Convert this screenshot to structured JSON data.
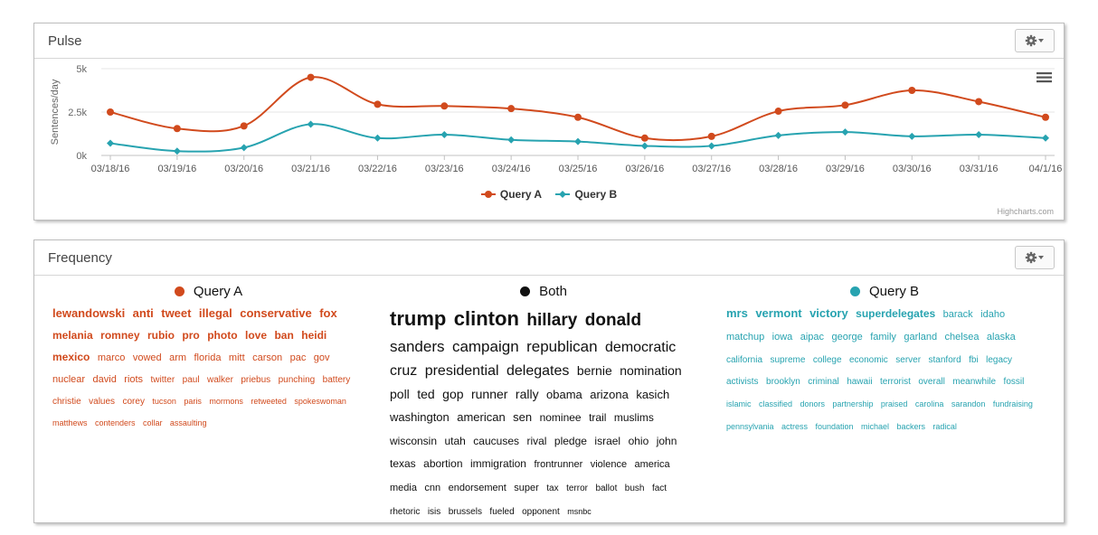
{
  "pulse": {
    "title": "Pulse",
    "credits": "Highcharts.com"
  },
  "frequency": {
    "title": "Frequency",
    "query_a_label": "Query A",
    "both_label": "Both",
    "query_b_label": "Query B",
    "query_a_words": [
      {
        "t": "lewandowski",
        "s": 13
      },
      {
        "t": "anti",
        "s": 13
      },
      {
        "t": "tweet",
        "s": 13
      },
      {
        "t": "illegal",
        "s": 13
      },
      {
        "t": "conservative",
        "s": 13
      },
      {
        "t": "fox",
        "s": 13
      },
      {
        "t": "melania",
        "s": 12
      },
      {
        "t": "romney",
        "s": 12
      },
      {
        "t": "rubio",
        "s": 12
      },
      {
        "t": "pro",
        "s": 12
      },
      {
        "t": "photo",
        "s": 12
      },
      {
        "t": "love",
        "s": 12
      },
      {
        "t": "ban",
        "s": 12
      },
      {
        "t": "heidi",
        "s": 12
      },
      {
        "t": "mexico",
        "s": 12
      },
      {
        "t": "marco",
        "s": 11
      },
      {
        "t": "vowed",
        "s": 11
      },
      {
        "t": "arm",
        "s": 11
      },
      {
        "t": "florida",
        "s": 11
      },
      {
        "t": "mitt",
        "s": 11
      },
      {
        "t": "carson",
        "s": 11
      },
      {
        "t": "pac",
        "s": 11
      },
      {
        "t": "gov",
        "s": 11
      },
      {
        "t": "nuclear",
        "s": 11
      },
      {
        "t": "david",
        "s": 11
      },
      {
        "t": "riots",
        "s": 11
      },
      {
        "t": "twitter",
        "s": 10
      },
      {
        "t": "paul",
        "s": 10
      },
      {
        "t": "walker",
        "s": 10
      },
      {
        "t": "priebus",
        "s": 10
      },
      {
        "t": "punching",
        "s": 10
      },
      {
        "t": "battery",
        "s": 10
      },
      {
        "t": "christie",
        "s": 10
      },
      {
        "t": "values",
        "s": 10
      },
      {
        "t": "corey",
        "s": 10
      },
      {
        "t": "tucson",
        "s": 9
      },
      {
        "t": "paris",
        "s": 9
      },
      {
        "t": "mormons",
        "s": 9
      },
      {
        "t": "retweeted",
        "s": 9
      },
      {
        "t": "spokeswoman",
        "s": 9
      },
      {
        "t": "matthews",
        "s": 9
      },
      {
        "t": "contenders",
        "s": 9
      },
      {
        "t": "collar",
        "s": 9
      },
      {
        "t": "assaulting",
        "s": 9
      }
    ],
    "both_words": [
      {
        "t": "trump",
        "s": 22
      },
      {
        "t": "clinton",
        "s": 22
      },
      {
        "t": "hillary",
        "s": 19
      },
      {
        "t": "donald",
        "s": 19
      },
      {
        "t": "sanders",
        "s": 17
      },
      {
        "t": "campaign",
        "s": 17
      },
      {
        "t": "republican",
        "s": 17
      },
      {
        "t": "democratic",
        "s": 16
      },
      {
        "t": "cruz",
        "s": 16
      },
      {
        "t": "presidential",
        "s": 16
      },
      {
        "t": "delegates",
        "s": 16
      },
      {
        "t": "bernie",
        "s": 14
      },
      {
        "t": "nomination",
        "s": 14
      },
      {
        "t": "poll",
        "s": 14
      },
      {
        "t": "ted",
        "s": 14
      },
      {
        "t": "gop",
        "s": 14
      },
      {
        "t": "runner",
        "s": 14
      },
      {
        "t": "rally",
        "s": 14
      },
      {
        "t": "obama",
        "s": 13
      },
      {
        "t": "arizona",
        "s": 13
      },
      {
        "t": "kasich",
        "s": 13
      },
      {
        "t": "washington",
        "s": 13
      },
      {
        "t": "american",
        "s": 13
      },
      {
        "t": "sen",
        "s": 13
      },
      {
        "t": "nominee",
        "s": 12
      },
      {
        "t": "trail",
        "s": 12
      },
      {
        "t": "muslims",
        "s": 12
      },
      {
        "t": "wisconsin",
        "s": 12
      },
      {
        "t": "utah",
        "s": 12
      },
      {
        "t": "caucuses",
        "s": 12
      },
      {
        "t": "rival",
        "s": 12
      },
      {
        "t": "pledge",
        "s": 12
      },
      {
        "t": "israel",
        "s": 12
      },
      {
        "t": "ohio",
        "s": 12
      },
      {
        "t": "john",
        "s": 12
      },
      {
        "t": "texas",
        "s": 12
      },
      {
        "t": "abortion",
        "s": 12
      },
      {
        "t": "immigration",
        "s": 12
      },
      {
        "t": "frontrunner",
        "s": 11
      },
      {
        "t": "violence",
        "s": 11
      },
      {
        "t": "america",
        "s": 11
      },
      {
        "t": "media",
        "s": 11
      },
      {
        "t": "cnn",
        "s": 11
      },
      {
        "t": "endorsement",
        "s": 11
      },
      {
        "t": "super",
        "s": 11
      },
      {
        "t": "tax",
        "s": 10
      },
      {
        "t": "terror",
        "s": 10
      },
      {
        "t": "ballot",
        "s": 10
      },
      {
        "t": "bush",
        "s": 10
      },
      {
        "t": "fact",
        "s": 10
      },
      {
        "t": "rhetoric",
        "s": 10
      },
      {
        "t": "isis",
        "s": 10
      },
      {
        "t": "brussels",
        "s": 10
      },
      {
        "t": "fueled",
        "s": 10
      },
      {
        "t": "opponent",
        "s": 10
      },
      {
        "t": "msnbc",
        "s": 9
      }
    ],
    "query_b_words": [
      {
        "t": "mrs",
        "s": 13
      },
      {
        "t": "vermont",
        "s": 13
      },
      {
        "t": "victory",
        "s": 13
      },
      {
        "t": "superdelegates",
        "s": 12
      },
      {
        "t": "barack",
        "s": 11
      },
      {
        "t": "idaho",
        "s": 11
      },
      {
        "t": "matchup",
        "s": 11
      },
      {
        "t": "iowa",
        "s": 11
      },
      {
        "t": "aipac",
        "s": 11
      },
      {
        "t": "george",
        "s": 11
      },
      {
        "t": "family",
        "s": 11
      },
      {
        "t": "garland",
        "s": 11
      },
      {
        "t": "chelsea",
        "s": 11
      },
      {
        "t": "alaska",
        "s": 11
      },
      {
        "t": "california",
        "s": 10
      },
      {
        "t": "supreme",
        "s": 10
      },
      {
        "t": "college",
        "s": 10
      },
      {
        "t": "economic",
        "s": 10
      },
      {
        "t": "server",
        "s": 10
      },
      {
        "t": "stanford",
        "s": 10
      },
      {
        "t": "fbi",
        "s": 10
      },
      {
        "t": "legacy",
        "s": 10
      },
      {
        "t": "activists",
        "s": 10
      },
      {
        "t": "brooklyn",
        "s": 10
      },
      {
        "t": "criminal",
        "s": 10
      },
      {
        "t": "hawaii",
        "s": 10
      },
      {
        "t": "terrorist",
        "s": 10
      },
      {
        "t": "overall",
        "s": 10
      },
      {
        "t": "meanwhile",
        "s": 10
      },
      {
        "t": "fossil",
        "s": 10
      },
      {
        "t": "islamic",
        "s": 9
      },
      {
        "t": "classified",
        "s": 9
      },
      {
        "t": "donors",
        "s": 9
      },
      {
        "t": "partnership",
        "s": 9
      },
      {
        "t": "praised",
        "s": 9
      },
      {
        "t": "carolina",
        "s": 9
      },
      {
        "t": "sarandon",
        "s": 9
      },
      {
        "t": "fundraising",
        "s": 9
      },
      {
        "t": "pennsylvania",
        "s": 9
      },
      {
        "t": "actress",
        "s": 9
      },
      {
        "t": "foundation",
        "s": 9
      },
      {
        "t": "michael",
        "s": 9
      },
      {
        "t": "backers",
        "s": 9
      },
      {
        "t": "radical",
        "s": 9
      }
    ]
  },
  "colors": {
    "query_a": "#d14a1d",
    "query_b": "#27a3b0",
    "both": "#111111"
  },
  "chart_data": {
    "type": "line",
    "ylabel": "Sentences/day",
    "ylim": [
      0,
      5000
    ],
    "yticks": [
      {
        "v": 0,
        "label": "0k"
      },
      {
        "v": 2500,
        "label": "2.5k"
      },
      {
        "v": 5000,
        "label": "5k"
      }
    ],
    "categories": [
      "03/18/16",
      "03/19/16",
      "03/20/16",
      "03/21/16",
      "03/22/16",
      "03/23/16",
      "03/24/16",
      "03/25/16",
      "03/26/16",
      "03/27/16",
      "03/28/16",
      "03/29/16",
      "03/30/16",
      "03/31/16",
      "04/1/16"
    ],
    "series": [
      {
        "name": "Query A",
        "color": "#d14a1d",
        "marker": "circle",
        "values": [
          2500,
          1550,
          1700,
          4500,
          2950,
          2850,
          2700,
          2200,
          1000,
          1100,
          2550,
          2900,
          3750,
          3100,
          2200
        ]
      },
      {
        "name": "Query B",
        "color": "#27a3b0",
        "marker": "diamond",
        "values": [
          700,
          250,
          450,
          1800,
          1000,
          1200,
          900,
          800,
          550,
          550,
          1150,
          1350,
          1100,
          1200,
          1000
        ]
      }
    ],
    "grid": true,
    "legend": "bottom-center"
  }
}
